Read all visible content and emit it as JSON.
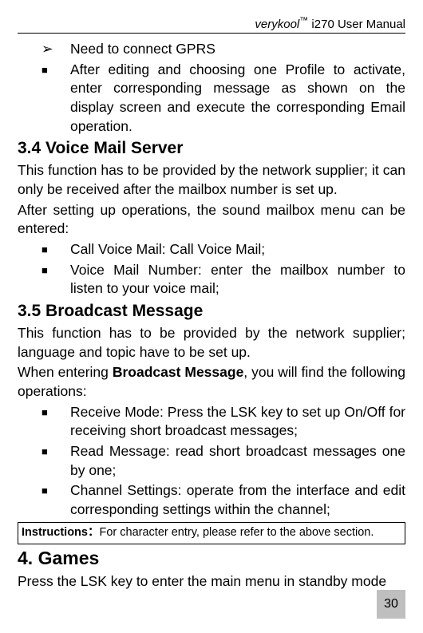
{
  "header": {
    "brand": "verykool",
    "tm": "™",
    "model": " i270 User Manual"
  },
  "bullets": {
    "gprs": "Need to connect GPRS",
    "after_editing": "After editing and choosing one Profile to activate, enter corresponding message as shown on the display screen and execute the corresponding Email operation."
  },
  "section34": {
    "heading": "3.4 Voice Mail Server",
    "para1": "This function has to be provided by the network supplier; it can only be received after the mailbox number is set up.",
    "para2": "After setting up operations, the sound mailbox menu can be entered:",
    "item1": "Call Voice Mail: Call Voice Mail;",
    "item2": "Voice Mail Number: enter the mailbox number to listen to your voice mail;"
  },
  "section35": {
    "heading": "3.5 Broadcast Message",
    "para1": "This function has to be provided by the network supplier; language and topic have to be set up.",
    "para2_pre": "When entering ",
    "para2_bold": "Broadcast Message",
    "para2_post": ", you will find the following operations:",
    "item1": "Receive Mode: Press the LSK key to set up On/Off for receiving short broadcast messages;",
    "item2": "Read Message: read short broadcast messages one by one;",
    "item3": "Channel Settings: operate from the interface and edit corresponding settings within the channel;"
  },
  "instructions": {
    "label": "Instructions：",
    "text": "For character entry, please refer to the above section."
  },
  "section4": {
    "heading": "4. Games",
    "para1": "Press the LSK key to enter the main menu in standby mode"
  },
  "pageNumber": "30"
}
